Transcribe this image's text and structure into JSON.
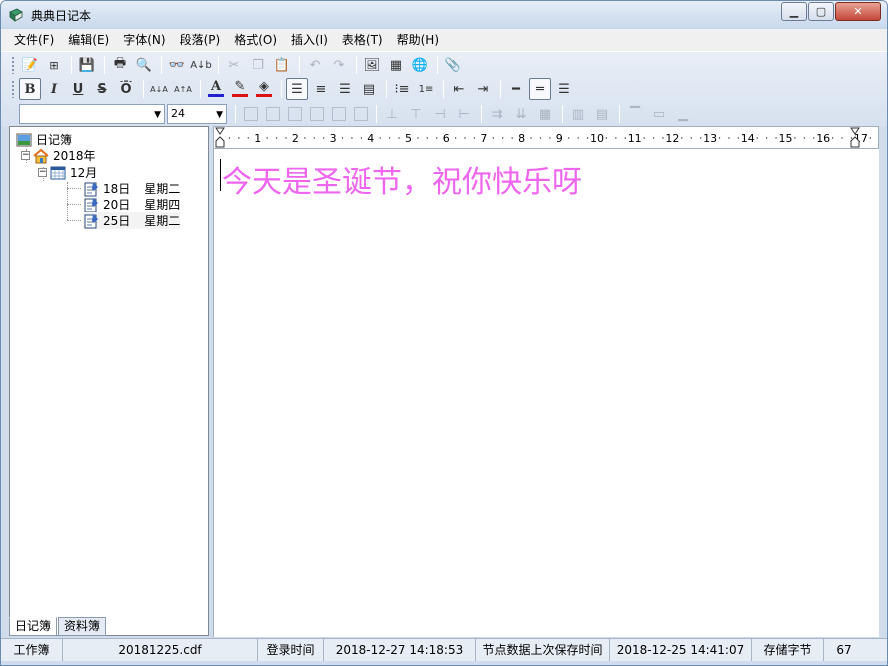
{
  "window": {
    "title": "典典日记本"
  },
  "menu": [
    "文件(F)",
    "编辑(E)",
    "字体(N)",
    "段落(P)",
    "格式(O)",
    "插入(I)",
    "表格(T)",
    "帮助(H)"
  ],
  "format_toolbar": {
    "bold": "B",
    "italic": "I",
    "underline": "U",
    "strike": "S",
    "overline": "Ō",
    "font_small": "A↓A",
    "font_big": "A↑A",
    "font_color": "A"
  },
  "font_size": {
    "value": "24"
  },
  "font_name": {
    "value": ""
  },
  "colors": {
    "font_color": "#2222cc",
    "highlight": "#dd1111",
    "fill": "#dd1111",
    "text": "#ee66ee"
  },
  "tree": {
    "root": "日记簿",
    "year": "2018年",
    "month": "12月",
    "entries": [
      {
        "day": "18日",
        "weekday": "星期二"
      },
      {
        "day": "20日",
        "weekday": "星期四"
      },
      {
        "day": "25日",
        "weekday": "星期二"
      }
    ]
  },
  "left_tabs": [
    "日记簿",
    "资料簿"
  ],
  "ruler": {
    "numbers": [
      "1",
      "2",
      "3",
      "4",
      "5",
      "6",
      "7",
      "8",
      "9",
      "10",
      "11",
      "12",
      "13",
      "14",
      "15",
      "16",
      "17"
    ]
  },
  "editor": {
    "content": "今天是圣诞节，祝你快乐呀"
  },
  "status": {
    "book_label": "工作簿",
    "file": "20181225.cdf",
    "login_label": "登录时间",
    "login_time": "2018-12-27 14:18:53",
    "save_label": "节点数据上次保存时间",
    "save_time": "2018-12-25 14:41:07",
    "bytes_label": "存储字节",
    "bytes": "67"
  }
}
